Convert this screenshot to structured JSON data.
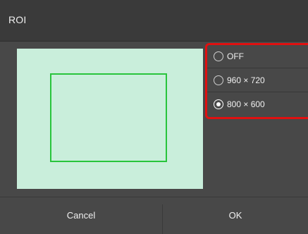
{
  "dialog": {
    "title": "ROI"
  },
  "options": [
    {
      "label": "OFF",
      "selected": false
    },
    {
      "label": "960 × 720",
      "selected": false
    },
    {
      "label": "800 × 600",
      "selected": true
    }
  ],
  "footer": {
    "cancel_label": "Cancel",
    "ok_label": "OK"
  },
  "colors": {
    "preview_bg": "#c9eedb",
    "roi_outline": "#28c43c",
    "highlight": "#e01010"
  }
}
